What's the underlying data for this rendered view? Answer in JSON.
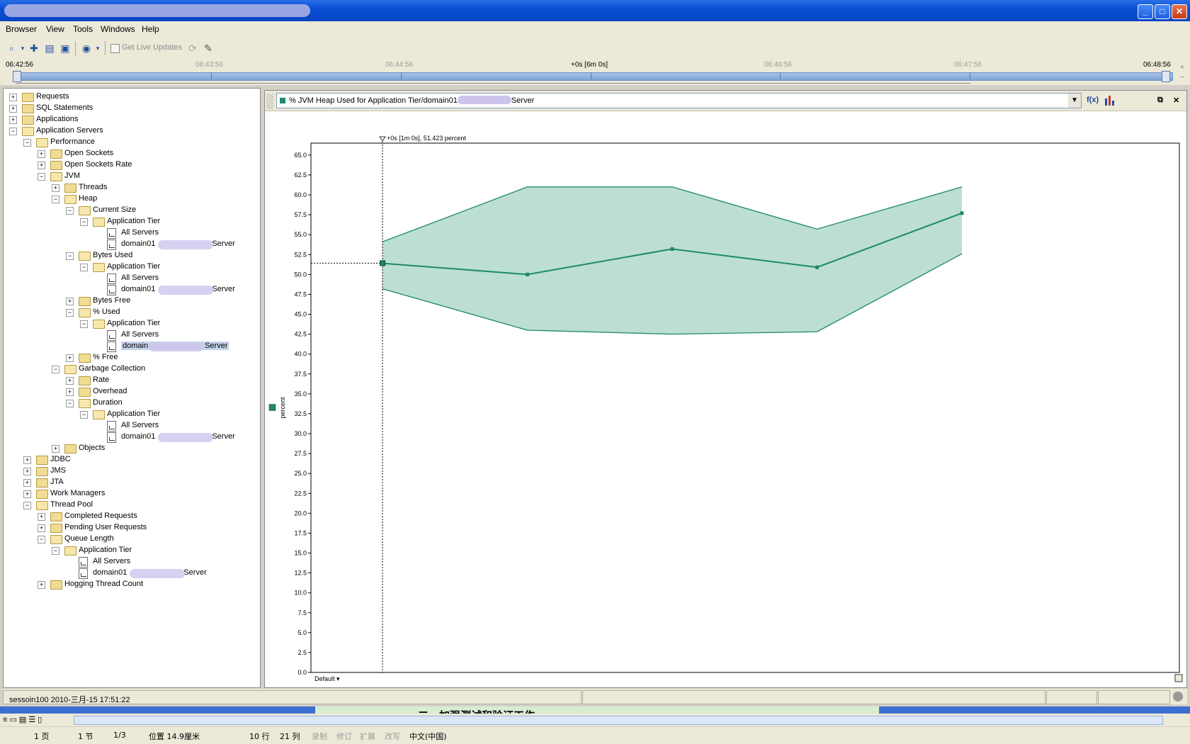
{
  "menu": [
    "Browser",
    "View",
    "Tools",
    "Windows",
    "Help"
  ],
  "toolbar": {
    "live_updates_label": "Get Live Updates"
  },
  "timeline": {
    "labels": [
      "06:42:56",
      "06:43:56",
      "06:44:56",
      "+0s [6m 0s]",
      "06:46:56",
      "06:47:56",
      "06:48:56"
    ]
  },
  "tree": [
    {
      "label": "Requests",
      "depth": 0,
      "state": "collapsed",
      "type": "folder"
    },
    {
      "label": "SQL Statements",
      "depth": 0,
      "state": "collapsed",
      "type": "folder"
    },
    {
      "label": "Applications",
      "depth": 0,
      "state": "collapsed",
      "type": "folder"
    },
    {
      "label": "Application Servers",
      "depth": 0,
      "state": "expanded",
      "type": "folder"
    },
    {
      "label": "Performance",
      "depth": 1,
      "state": "expanded",
      "type": "folder"
    },
    {
      "label": "Open Sockets",
      "depth": 2,
      "state": "collapsed",
      "type": "folder"
    },
    {
      "label": "Open Sockets Rate",
      "depth": 2,
      "state": "collapsed",
      "type": "folder"
    },
    {
      "label": "JVM",
      "depth": 2,
      "state": "expanded",
      "type": "folder"
    },
    {
      "label": "Threads",
      "depth": 3,
      "state": "collapsed",
      "type": "folder"
    },
    {
      "label": "Heap",
      "depth": 3,
      "state": "expanded",
      "type": "folder"
    },
    {
      "label": "Current Size",
      "depth": 4,
      "state": "expanded",
      "type": "folder"
    },
    {
      "label": "Application Tier",
      "depth": 5,
      "state": "expanded",
      "type": "folder"
    },
    {
      "label": "All Servers",
      "depth": 6,
      "state": "leaf",
      "type": "chart"
    },
    {
      "label": "domain01",
      "suffix": "Server",
      "depth": 6,
      "state": "leaf",
      "type": "chart",
      "blurred": true
    },
    {
      "label": "Bytes Used",
      "depth": 4,
      "state": "expanded",
      "type": "folder"
    },
    {
      "label": "Application Tier",
      "depth": 5,
      "state": "expanded",
      "type": "folder"
    },
    {
      "label": "All Servers",
      "depth": 6,
      "state": "leaf",
      "type": "chart"
    },
    {
      "label": "domain01",
      "suffix": "Server",
      "depth": 6,
      "state": "leaf",
      "type": "chart",
      "blurred": true
    },
    {
      "label": "Bytes Free",
      "depth": 4,
      "state": "collapsed",
      "type": "folder"
    },
    {
      "label": "% Used",
      "depth": 4,
      "state": "expanded",
      "type": "folder"
    },
    {
      "label": "Application Tier",
      "depth": 5,
      "state": "expanded",
      "type": "folder"
    },
    {
      "label": "All Servers",
      "depth": 6,
      "state": "leaf",
      "type": "chart"
    },
    {
      "label": "domain",
      "suffix": "Server",
      "depth": 6,
      "state": "leaf",
      "type": "chart",
      "blurred": true,
      "selected": true
    },
    {
      "label": "% Free",
      "depth": 4,
      "state": "collapsed",
      "type": "folder"
    },
    {
      "label": "Garbage Collection",
      "depth": 3,
      "state": "expanded",
      "type": "folder"
    },
    {
      "label": "Rate",
      "depth": 4,
      "state": "collapsed",
      "type": "folder"
    },
    {
      "label": "Overhead",
      "depth": 4,
      "state": "collapsed",
      "type": "folder"
    },
    {
      "label": "Duration",
      "depth": 4,
      "state": "expanded",
      "type": "folder"
    },
    {
      "label": "Application Tier",
      "depth": 5,
      "state": "expanded",
      "type": "folder"
    },
    {
      "label": "All Servers",
      "depth": 6,
      "state": "leaf",
      "type": "chart"
    },
    {
      "label": "domain01",
      "suffix": "Server",
      "depth": 6,
      "state": "leaf",
      "type": "chart",
      "blurred": true
    },
    {
      "label": "Objects",
      "depth": 3,
      "state": "collapsed",
      "type": "folder"
    },
    {
      "label": "JDBC",
      "depth": 1,
      "state": "collapsed",
      "type": "folder"
    },
    {
      "label": "JMS",
      "depth": 1,
      "state": "collapsed",
      "type": "folder"
    },
    {
      "label": "JTA",
      "depth": 1,
      "state": "collapsed",
      "type": "folder"
    },
    {
      "label": "Work Managers",
      "depth": 1,
      "state": "collapsed",
      "type": "folder"
    },
    {
      "label": "Thread Pool",
      "depth": 1,
      "state": "expanded",
      "type": "folder"
    },
    {
      "label": "Completed Requests",
      "depth": 2,
      "state": "collapsed",
      "type": "folder"
    },
    {
      "label": "Pending User Requests",
      "depth": 2,
      "state": "collapsed",
      "type": "folder"
    },
    {
      "label": "Queue Length",
      "depth": 2,
      "state": "expanded",
      "type": "folder"
    },
    {
      "label": "Application Tier",
      "depth": 3,
      "state": "expanded",
      "type": "folder"
    },
    {
      "label": "All Servers",
      "depth": 4,
      "state": "leaf",
      "type": "chart"
    },
    {
      "label": "domain01",
      "suffix": "Server",
      "depth": 4,
      "state": "leaf",
      "type": "chart",
      "blurred": true
    },
    {
      "label": "Hogging Thread Count",
      "depth": 2,
      "state": "collapsed",
      "type": "folder"
    }
  ],
  "chart_header": {
    "title_prefix": "% JVM Heap Used for Application Tier/domain01",
    "title_suffix": "Server",
    "series_color": "#1c8a64"
  },
  "chart_data": {
    "type": "area",
    "ylabel": "percent",
    "ylim": [
      0,
      66.5
    ],
    "yticks": [
      "0.0",
      "2.5",
      "5.0",
      "7.5",
      "10.0",
      "12.5",
      "15.0",
      "17.5",
      "20.0",
      "22.5",
      "25.0",
      "27.5",
      "30.0",
      "32.5",
      "35.0",
      "37.5",
      "40.0",
      "42.5",
      "45.0",
      "47.5",
      "50.0",
      "52.5",
      "55.0",
      "57.5",
      "60.0",
      "62.5",
      "65.0"
    ],
    "x_minutes": [
      1,
      2,
      3,
      4,
      5
    ],
    "series": [
      {
        "values": [
          51.4,
          50.0,
          53.2,
          50.9,
          57.7
        ],
        "upper": [
          54.1,
          61.0,
          61.0,
          55.7,
          61.0
        ],
        "lower": [
          48.2,
          43.0,
          42.5,
          42.8,
          52.6
        ]
      }
    ],
    "cursor": {
      "label": "+0s [1m 0s], 51.423 percent",
      "x_minutes": 1,
      "value": 51.423
    },
    "legend_swatch_color": "#1c8a64",
    "footer_label": "Default"
  },
  "status": {
    "text": "sessoin100 2010-三月-15 17:51:22"
  },
  "word_status": [
    "1 页",
    "1 节",
    "1/3",
    "位置 14.9厘米",
    "10 行",
    "21 列",
    "录制",
    "修订",
    "扩展",
    "改写",
    "中文(中国)"
  ],
  "doc_fragment": "二、加强测试和验证工作"
}
